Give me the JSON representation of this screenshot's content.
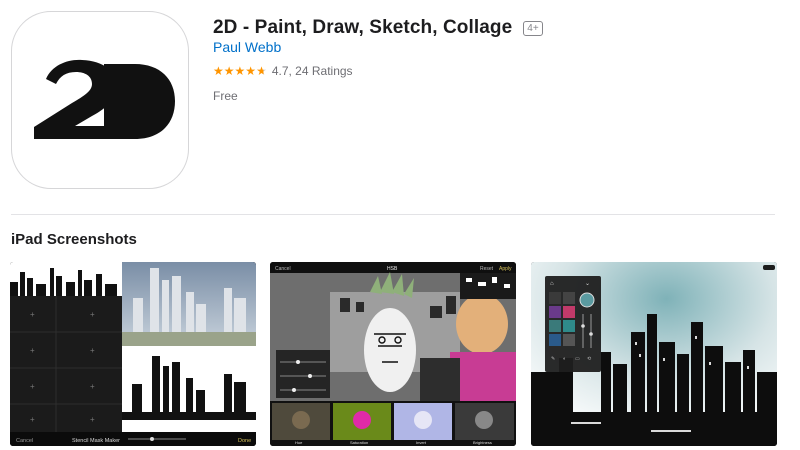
{
  "app": {
    "title": "2D - Paint, Draw, Sketch, Collage",
    "age_rating": "4+",
    "developer": "Paul Webb",
    "rating": {
      "stars": 4.7,
      "text": "4.7, 24 Ratings"
    },
    "price": "Free",
    "icon": {
      "name": "app-icon-2d",
      "text": "2D"
    }
  },
  "screenshots": {
    "title": "iPad Screenshots",
    "items": [
      {
        "name": "screenshot-1",
        "ui": {
          "bottom_left": "Cancel",
          "bottom_center": "Stencil Mask Maker",
          "bottom_right": "Done"
        }
      },
      {
        "name": "screenshot-2",
        "ui": {
          "top_left": "Cancel",
          "top_center": "HSB",
          "top_right_1": "Reset",
          "top_right_2": "Apply",
          "thumbs": [
            "Hue",
            "Saturation",
            "Invert",
            "Brightness"
          ]
        }
      },
      {
        "name": "screenshot-3"
      }
    ]
  },
  "colors": {
    "link": "#0070c9",
    "star": "#ff9500",
    "text_secondary": "#6e6e73"
  }
}
